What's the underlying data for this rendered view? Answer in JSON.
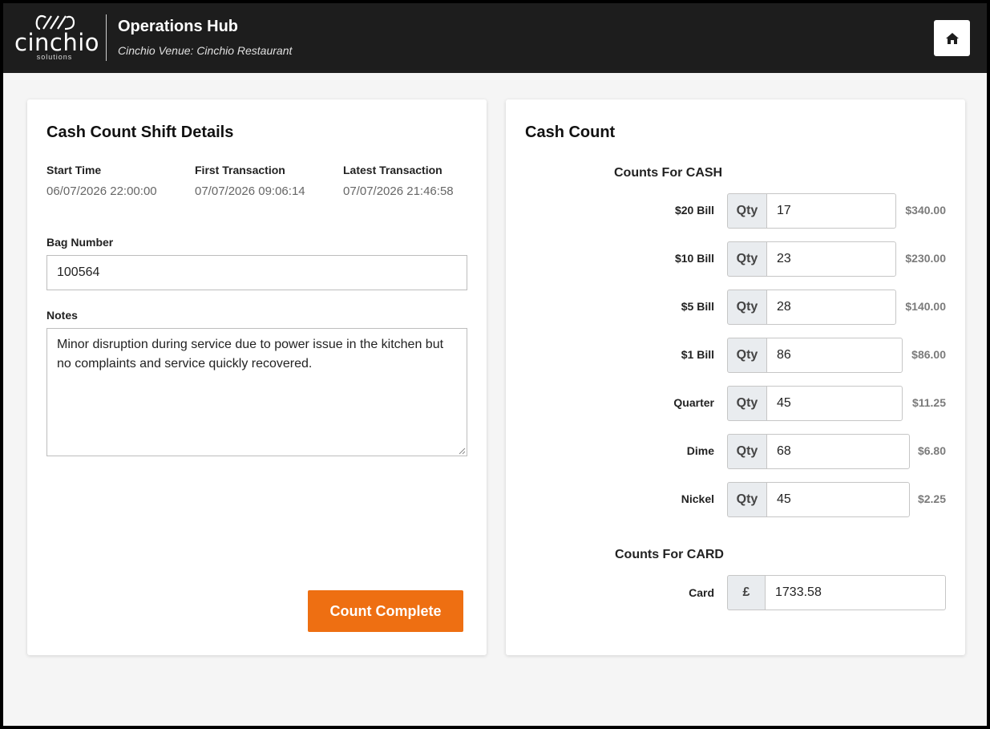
{
  "header": {
    "logo_word": "cinchio",
    "logo_sub": "solutions",
    "app_title": "Operations Hub",
    "venue": "Cinchio Venue: Cinchio Restaurant"
  },
  "shift": {
    "title": "Cash Count Shift Details",
    "start_time_label": "Start Time",
    "start_time": "06/07/2026 22:00:00",
    "first_tx_label": "First Transaction",
    "first_tx": "07/07/2026 09:06:14",
    "latest_tx_label": "Latest Transaction",
    "latest_tx": "07/07/2026 21:46:58",
    "bag_label": "Bag Number",
    "bag_value": "100564",
    "notes_label": "Notes",
    "notes_value": "Minor disruption during service due to power issue in the kitchen but no complaints and service quickly recovered.",
    "complete_label": "Count Complete"
  },
  "count": {
    "title": "Cash Count",
    "cash_heading": "Counts For CASH",
    "qty_label": "Qty",
    "rows": [
      {
        "label": "$20 Bill",
        "qty": "17",
        "amount": "$340.00"
      },
      {
        "label": "$10 Bill",
        "qty": "23",
        "amount": "$230.00"
      },
      {
        "label": "$5 Bill",
        "qty": "28",
        "amount": "$140.00"
      },
      {
        "label": "$1 Bill",
        "qty": "86",
        "amount": "$86.00"
      },
      {
        "label": "Quarter",
        "qty": "45",
        "amount": "$11.25"
      },
      {
        "label": "Dime",
        "qty": "68",
        "amount": "$6.80"
      },
      {
        "label": "Nickel",
        "qty": "45",
        "amount": "$2.25"
      }
    ],
    "card_heading": "Counts For CARD",
    "card_label": "Card",
    "card_symbol": "£",
    "card_value": "1733.58"
  },
  "colors": {
    "header_bg": "#1d1d1d",
    "accent": "#ee6f12",
    "page_bg": "#f5f5f5"
  },
  "icons": {
    "home": "home-icon",
    "logo": "cinchio-logo-icon"
  }
}
